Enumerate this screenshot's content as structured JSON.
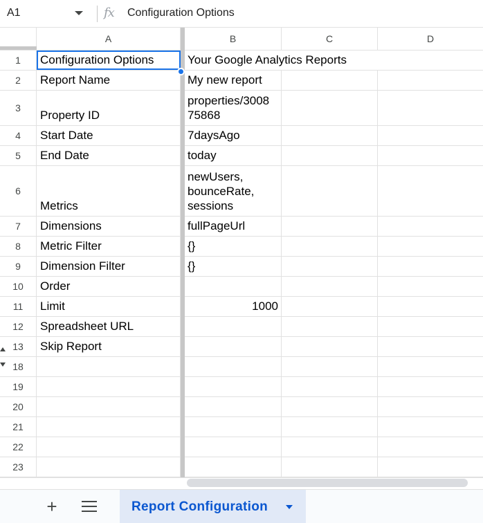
{
  "formula_bar": {
    "name_box": "A1",
    "fx_symbol": "fx",
    "formula": "Configuration Options"
  },
  "columns": [
    "A",
    "B",
    "C",
    "D"
  ],
  "rows": [
    {
      "num": "1",
      "a": "Configuration Options",
      "b": "Your Google Analytics Reports"
    },
    {
      "num": "2",
      "a": "Report Name",
      "b": "My new report"
    },
    {
      "num": "3",
      "a": "Property ID",
      "b": "properties/3008\n75868"
    },
    {
      "num": "4",
      "a": "Start Date",
      "b": "7daysAgo"
    },
    {
      "num": "5",
      "a": "End Date",
      "b": "today"
    },
    {
      "num": "6",
      "a": "Metrics",
      "b": "newUsers,\nbounceRate,\nsessions"
    },
    {
      "num": "7",
      "a": "Dimensions",
      "b": "fullPageUrl"
    },
    {
      "num": "8",
      "a": "Metric Filter",
      "b": "{}"
    },
    {
      "num": "9",
      "a": "Dimension Filter",
      "b": "{}"
    },
    {
      "num": "10",
      "a": "Order",
      "b": ""
    },
    {
      "num": "11",
      "a": "Limit",
      "b": "1000"
    },
    {
      "num": "12",
      "a": "Spreadsheet URL",
      "b": ""
    },
    {
      "num": "13",
      "a": "Skip Report",
      "b": ""
    },
    {
      "num": "18",
      "a": "",
      "b": ""
    },
    {
      "num": "19",
      "a": "",
      "b": ""
    },
    {
      "num": "20",
      "a": "",
      "b": ""
    },
    {
      "num": "21",
      "a": "",
      "b": ""
    },
    {
      "num": "22",
      "a": "",
      "b": ""
    },
    {
      "num": "23",
      "a": "",
      "b": ""
    }
  ],
  "sheet_tabs": {
    "add_icon": "+",
    "active_tab": "Report Configuration"
  }
}
